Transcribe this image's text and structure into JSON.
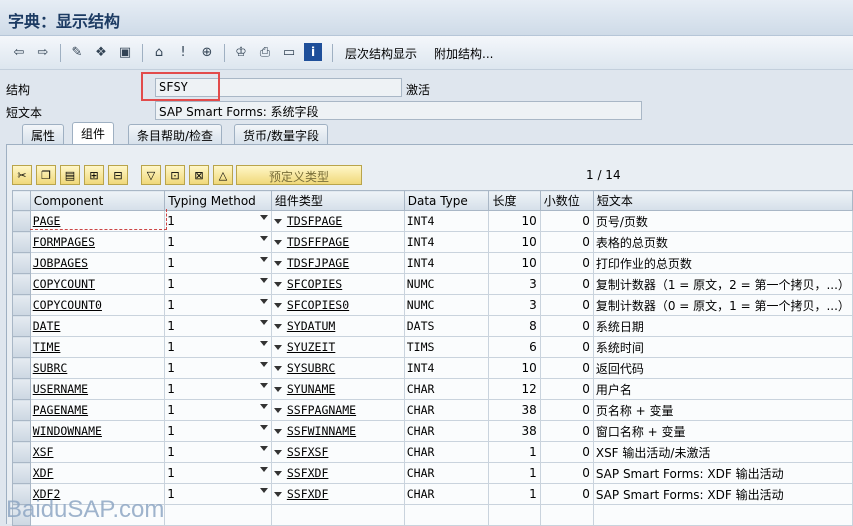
{
  "window": {
    "title": "字典：显示结构"
  },
  "toolbar": {
    "icons": [
      "back-arrow-icon",
      "forward-arrow-icon",
      "display-change-icon",
      "other-object-icon",
      "activate-icon",
      "where-used-icon",
      "info-icon",
      "navigate-icon",
      "hierarchy-icon",
      "print-icon",
      "layout-icon",
      "help-icon"
    ],
    "menu_hierarchy": "层次结构显示",
    "menu_append": "附加结构..."
  },
  "header": {
    "structure_label": "结构",
    "structure_value": "SFSY",
    "status": "激活",
    "short_text_label": "短文本",
    "short_text_value": "SAP Smart Forms: 系统字段"
  },
  "tabs": [
    {
      "label": "属性",
      "active": false
    },
    {
      "label": "组件",
      "active": true
    },
    {
      "label": "条目帮助/检查",
      "active": false
    },
    {
      "label": "货币/数量字段",
      "active": false
    }
  ],
  "components_toolbar": {
    "predefined_type": "预定义类型",
    "page_indicator": "1  /  14"
  },
  "table": {
    "headers": [
      "Component",
      "Typing Method",
      "组件类型",
      "Data Type",
      "长度",
      "小数位",
      "短文本"
    ],
    "rows": [
      {
        "component": "PAGE",
        "typing": "1",
        "ctype": "TDSFPAGE",
        "dtype": "INT4",
        "length": "10",
        "decimals": "0",
        "text": "页号/页数"
      },
      {
        "component": "FORMPAGES",
        "typing": "1",
        "ctype": "TDSFFPAGE",
        "dtype": "INT4",
        "length": "10",
        "decimals": "0",
        "text": "表格的总页数"
      },
      {
        "component": "JOBPAGES",
        "typing": "1",
        "ctype": "TDSFJPAGE",
        "dtype": "INT4",
        "length": "10",
        "decimals": "0",
        "text": "打印作业的总页数"
      },
      {
        "component": "COPYCOUNT",
        "typing": "1",
        "ctype": "SFCOPIES",
        "dtype": "NUMC",
        "length": "3",
        "decimals": "0",
        "text": "复制计数器（1 = 原文，2 = 第一个拷贝，...）"
      },
      {
        "component": "COPYCOUNT0",
        "typing": "1",
        "ctype": "SFCOPIES0",
        "dtype": "NUMC",
        "length": "3",
        "decimals": "0",
        "text": "复制计数器（0 = 原文，1 = 第一个拷贝，...）"
      },
      {
        "component": "DATE",
        "typing": "1",
        "ctype": "SYDATUM",
        "dtype": "DATS",
        "length": "8",
        "decimals": "0",
        "text": "系统日期"
      },
      {
        "component": "TIME",
        "typing": "1",
        "ctype": "SYUZEIT",
        "dtype": "TIMS",
        "length": "6",
        "decimals": "0",
        "text": "系统时间"
      },
      {
        "component": "SUBRC",
        "typing": "1",
        "ctype": "SYSUBRC",
        "dtype": "INT4",
        "length": "10",
        "decimals": "0",
        "text": "返回代码"
      },
      {
        "component": "USERNAME",
        "typing": "1",
        "ctype": "SYUNAME",
        "dtype": "CHAR",
        "length": "12",
        "decimals": "0",
        "text": "用户名"
      },
      {
        "component": "PAGENAME",
        "typing": "1",
        "ctype": "SSFPAGNAME",
        "dtype": "CHAR",
        "length": "38",
        "decimals": "0",
        "text": "页名称 + 变量"
      },
      {
        "component": "WINDOWNAME",
        "typing": "1",
        "ctype": "SSFWINNAME",
        "dtype": "CHAR",
        "length": "38",
        "decimals": "0",
        "text": "窗口名称 + 变量"
      },
      {
        "component": "XSF",
        "typing": "1",
        "ctype": "SSFXSF",
        "dtype": "CHAR",
        "length": "1",
        "decimals": "0",
        "text": "XSF 输出活动/未激活"
      },
      {
        "component": "XDF",
        "typing": "1",
        "ctype": "SSFXDF",
        "dtype": "CHAR",
        "length": "1",
        "decimals": "0",
        "text": "SAP Smart Forms: XDF 输出活动"
      },
      {
        "component": "XDF2",
        "typing": "1",
        "ctype": "SSFXDF",
        "dtype": "CHAR",
        "length": "1",
        "decimals": "0",
        "text": "SAP Smart Forms: XDF 输出活动"
      }
    ]
  },
  "watermark": "BaiduSAP.com"
}
